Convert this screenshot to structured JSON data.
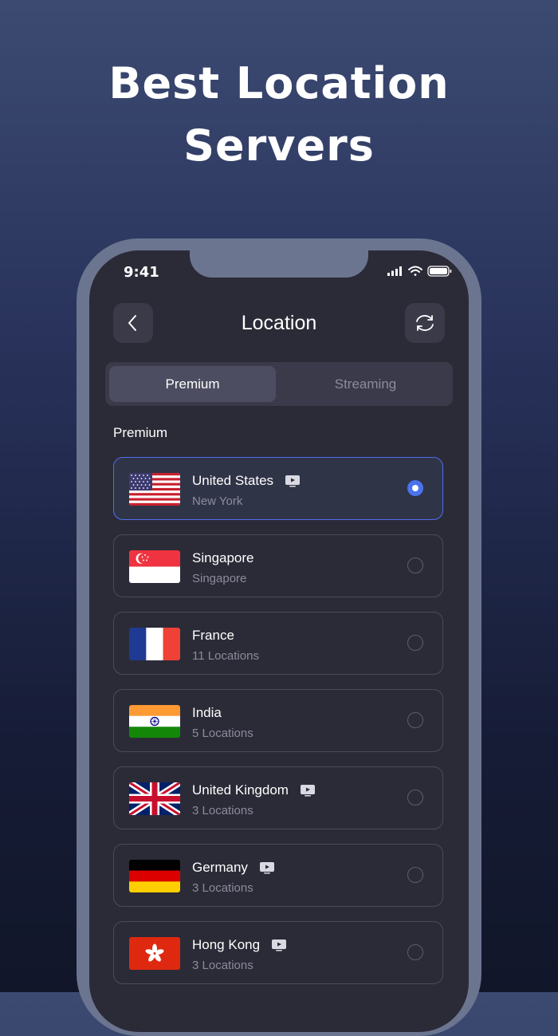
{
  "hero": {
    "line1": "Best Location",
    "line2": "Servers"
  },
  "status": {
    "time": "9:41"
  },
  "header": {
    "title": "Location",
    "back_icon": "chevron-left-icon",
    "refresh_icon": "refresh-icon"
  },
  "tabs": [
    {
      "label": "Premium",
      "active": true
    },
    {
      "label": "Streaming",
      "active": false
    }
  ],
  "section": {
    "title": "Premium"
  },
  "locations": [
    {
      "country": "United States",
      "detail": "New York",
      "streaming": true,
      "selected": true,
      "flag": "us-flag-icon"
    },
    {
      "country": "Singapore",
      "detail": "Singapore",
      "streaming": false,
      "selected": false,
      "flag": "sg-flag-icon"
    },
    {
      "country": "France",
      "detail": "11 Locations",
      "streaming": false,
      "selected": false,
      "flag": "fr-flag-icon"
    },
    {
      "country": "India",
      "detail": "5 Locations",
      "streaming": false,
      "selected": false,
      "flag": "in-flag-icon"
    },
    {
      "country": "United Kingdom",
      "detail": "3 Locations",
      "streaming": true,
      "selected": false,
      "flag": "uk-flag-icon"
    },
    {
      "country": "Germany",
      "detail": "3 Locations",
      "streaming": true,
      "selected": false,
      "flag": "de-flag-icon"
    },
    {
      "country": "Hong Kong",
      "detail": "3 Locations",
      "streaming": true,
      "selected": false,
      "flag": "hk-flag-icon"
    }
  ],
  "colors": {
    "accent": "#4a73ee",
    "background_top": "#3c4a72",
    "card": "#2b2b38"
  }
}
